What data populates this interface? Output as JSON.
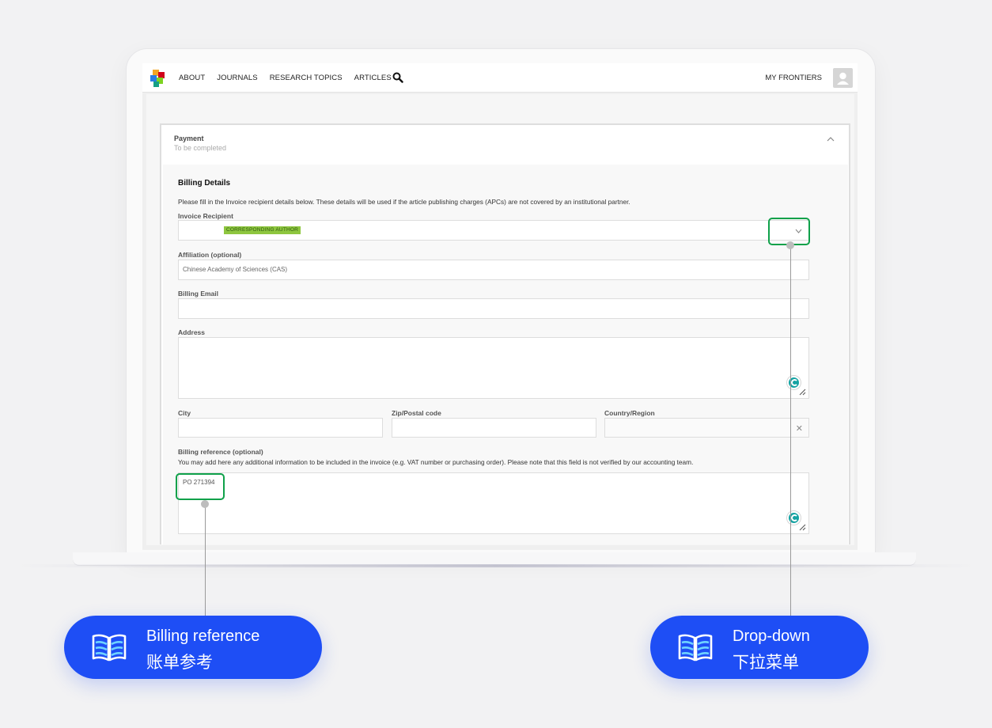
{
  "nav": {
    "items": [
      "ABOUT",
      "JOURNALS",
      "RESEARCH TOPICS",
      "ARTICLES"
    ],
    "my_frontiers": "MY FRONTIERS"
  },
  "panel": {
    "title": "Payment",
    "subtitle": "To be completed"
  },
  "billing": {
    "heading": "Billing Details",
    "intro": "Please fill in the Invoice recipient details below. These details will be used if the article publishing charges (APCs) are not covered by an institutional partner.",
    "invoice_recipient_label": "Invoice Recipient",
    "invoice_recipient_badge": "CORRESPONDING AUTHOR",
    "affiliation_label": "Affiliation (optional)",
    "affiliation_value": "Chinese Academy of Sciences (CAS)",
    "email_label": "Billing Email",
    "address_label": "Address",
    "city_label": "City",
    "zip_label": "Zip/Postal code",
    "country_label": "Country/Region",
    "reference_label": "Billing reference (optional)",
    "reference_help": "You may add here any additional information to be included in the invoice (e.g. VAT number or purchasing order). Please note that this field is not verified by our accounting team.",
    "reference_value": "PO 271394"
  },
  "callouts": {
    "left": {
      "en": "Billing reference",
      "zh": "账单参考"
    },
    "right": {
      "en": "Drop-down",
      "zh": "下拉菜单"
    }
  },
  "colors": {
    "highlight": "#0fa14a",
    "callout": "#1e4ef5",
    "badge": "#8ec63f"
  }
}
